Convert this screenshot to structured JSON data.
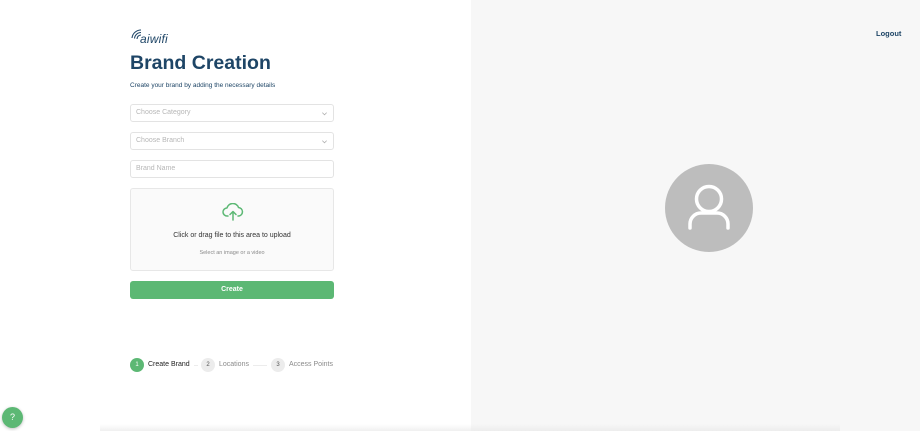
{
  "brand": {
    "logo_text": "aiwifi"
  },
  "header": {
    "logout_label": "Logout"
  },
  "form": {
    "title": "Brand Creation",
    "subtitle": "Create your brand by adding the necessary details",
    "category_placeholder": "Choose Category",
    "branch_placeholder": "Choose Branch",
    "brand_name_placeholder": "Brand Name",
    "upload_title": "Click or drag file to this area to upload",
    "upload_hint": "Select an image or a video",
    "create_label": "Create"
  },
  "steps": [
    {
      "number": "1",
      "label": "Create Brand",
      "state": "active"
    },
    {
      "number": "2",
      "label": "Locations",
      "state": "inactive"
    },
    {
      "number": "3",
      "label": "Access Points",
      "state": "inactive"
    }
  ],
  "help": {
    "label": "?"
  },
  "colors": {
    "primary_green": "#5cb874",
    "heading_navy": "#1e4566",
    "right_panel_bg": "#f7f7f7",
    "avatar_gray": "#bdbdbd"
  },
  "icons": {
    "logo": "wifi-signal-icon",
    "select_chevron": "chevron-down-icon",
    "upload": "cloud-upload-icon",
    "avatar": "user-icon"
  }
}
